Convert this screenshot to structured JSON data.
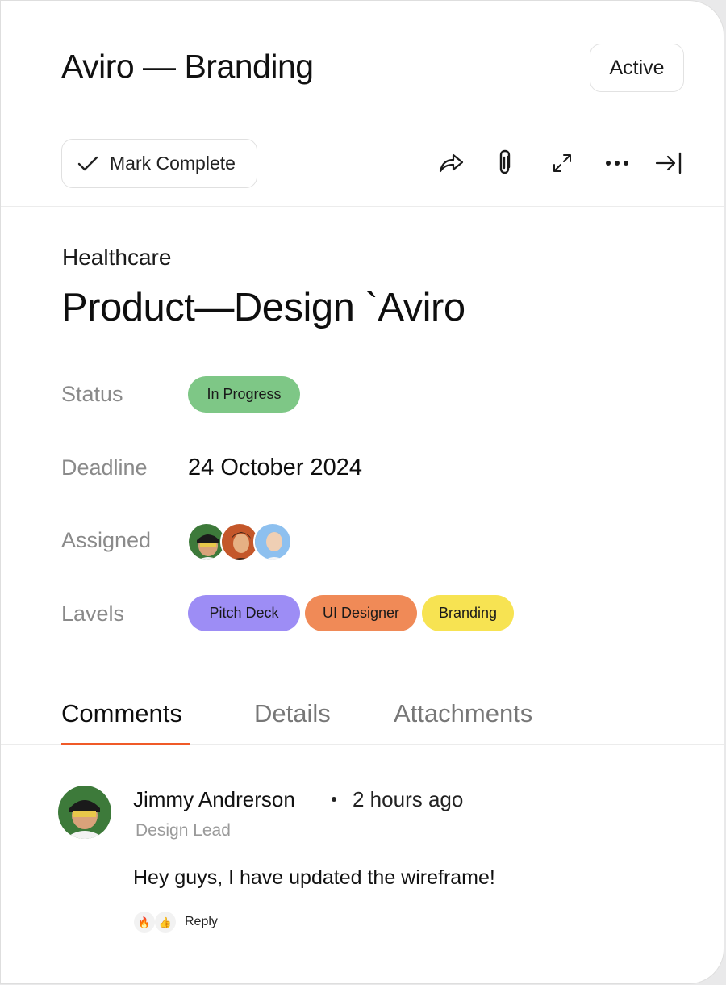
{
  "header": {
    "title": "Aviro — Branding",
    "status_button": "Active"
  },
  "toolbar": {
    "mark_complete": "Mark Complete",
    "icons": [
      "check-icon",
      "share-icon",
      "paperclip-icon",
      "expand-icon",
      "more-icon",
      "collapse-panel-icon"
    ]
  },
  "task": {
    "category": "Healthcare",
    "title": "Product—Design `Aviro",
    "fields": {
      "status_label": "Status",
      "status_value": "In Progress",
      "deadline_label": "Deadline",
      "deadline_value": "24 October 2024",
      "assigned_label": "Assigned",
      "labels_label": "Lavels"
    },
    "labels": [
      {
        "text": "Pitch Deck",
        "color": "#9d8df5"
      },
      {
        "text": "UI Designer",
        "color": "#f08a57"
      },
      {
        "text": "Branding",
        "color": "#f7e352"
      }
    ],
    "status_color": "#7ec786"
  },
  "tabs": [
    "Comments",
    "Details",
    "Attachments"
  ],
  "active_tab_color": "#f05a28",
  "comment": {
    "author": "Jimmy Andrerson",
    "time": "2 hours ago",
    "role": "Design Lead",
    "text": "Hey guys, I have updated the wireframe!",
    "reactions": [
      "🔥",
      "👍"
    ],
    "reply_label": "Reply"
  }
}
